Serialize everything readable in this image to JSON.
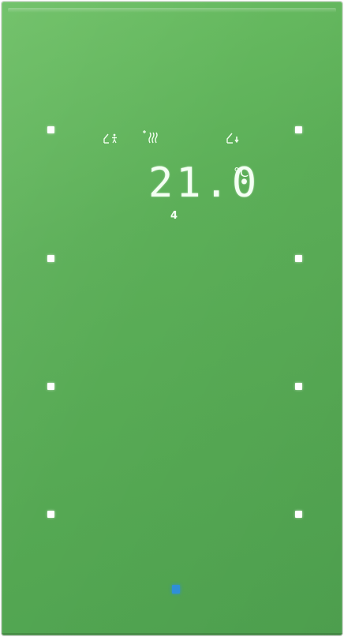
{
  "display": {
    "temperature": "21.0",
    "unit": "°C",
    "level": "4"
  },
  "icons": {
    "left": "presence-mode-icon",
    "middle": "heating-icon",
    "right": "standby-mode-icon"
  },
  "colors": {
    "panel": "#5caf58",
    "key": "#ffffff",
    "display_text": "#f4fff3",
    "status_led": "#2f8fd8"
  }
}
